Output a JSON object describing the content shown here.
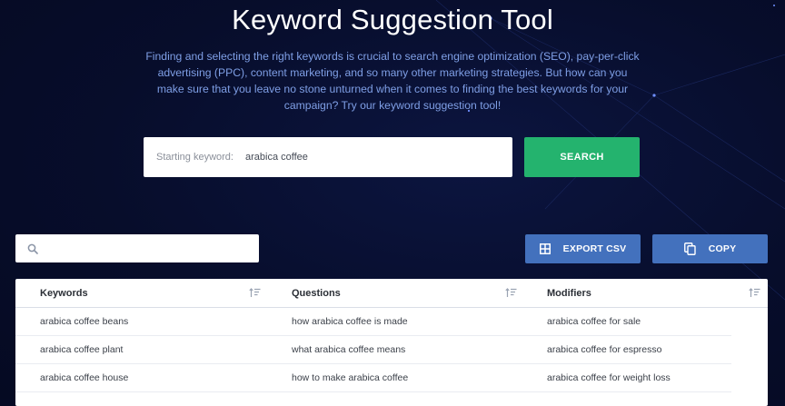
{
  "header": {
    "title": "Keyword Suggestion Tool",
    "intro": "Finding and selecting the right keywords is crucial to search engine optimization (SEO), pay-per-click advertising (PPC), content marketing, and so many other marketing strategies. But how can you make sure that you leave no stone unturned when it comes to finding the best keywords for your campaign? Try our keyword suggestion tool!"
  },
  "search": {
    "label": "Starting keyword:",
    "value": "arabica coffee",
    "button_label": "SEARCH"
  },
  "toolbar": {
    "filter_value": "",
    "export_label": "EXPORT CSV",
    "copy_label": "COPY"
  },
  "results": {
    "columns": [
      {
        "header": "Keywords",
        "rows": [
          "arabica coffee beans",
          "arabica coffee plant",
          "arabica coffee house"
        ]
      },
      {
        "header": "Questions",
        "rows": [
          "how arabica coffee is made",
          "what arabica coffee means",
          "how to make arabica coffee"
        ]
      },
      {
        "header": "Modifiers",
        "rows": [
          "arabica coffee for sale",
          "arabica coffee for espresso",
          "arabica coffee for weight loss"
        ]
      }
    ]
  },
  "icons": {
    "filter": "search-icon",
    "export": "grid-icon",
    "copy": "copy-icon",
    "sort": "sort-icon"
  },
  "colors": {
    "background": "#070d2b",
    "intro_text": "#7f9fe6",
    "search_button": "#24b36e",
    "action_button": "#4371bd"
  }
}
